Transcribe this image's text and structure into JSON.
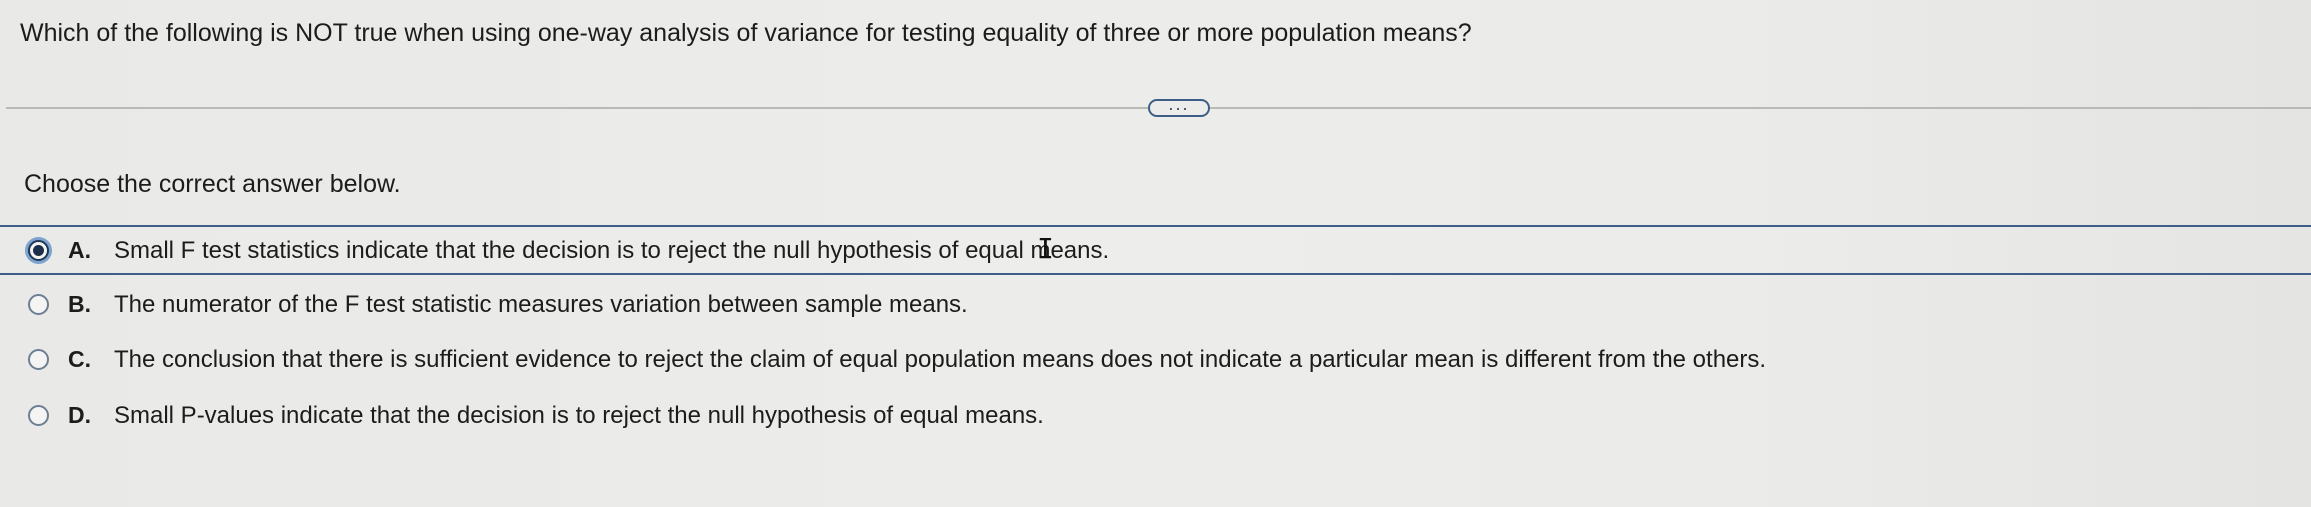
{
  "question": {
    "text": "Which of the following is NOT true when using one-way analysis of variance for testing equality of three or more population means?"
  },
  "more_button": {
    "label": "..."
  },
  "prompt": {
    "text": "Choose the correct answer below."
  },
  "options": [
    {
      "letter": "A.",
      "text": "Small F test statistics indicate that the decision is to reject the null hypothesis of equal means.",
      "selected": true
    },
    {
      "letter": "B.",
      "text": "The numerator of the F test statistic measures variation between sample means.",
      "selected": false
    },
    {
      "letter": "C.",
      "text": "The conclusion that there is sufficient evidence to reject the claim of equal population means does not indicate a particular mean is different from the others.",
      "selected": false
    },
    {
      "letter": "D.",
      "text": "Small P-values indicate that the decision is to reject the null hypothesis of equal means.",
      "selected": false
    }
  ],
  "icons": {
    "text_cursor": "I-beam-cursor-icon"
  },
  "colors": {
    "accent": "#3f5f88",
    "radio_selected": "#1c2f4a"
  }
}
